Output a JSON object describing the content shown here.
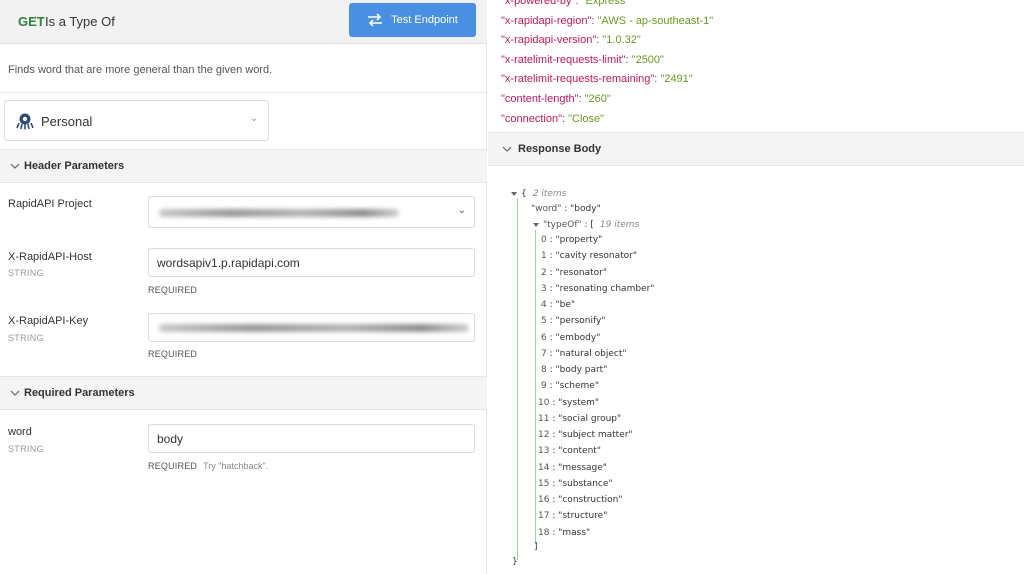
{
  "endpoint": {
    "method": "GET",
    "name": "Is a Type Of",
    "test_button_label": "Test Endpoint",
    "description": "Finds word that are more general than the given word."
  },
  "account_select": {
    "label": "Personal"
  },
  "header_parameters": {
    "title": "Header Parameters",
    "project_label": "RapidAPI Project",
    "host_label": "X-RapidAPI-Host",
    "host_type": "STRING",
    "host_value": "wordsapiv1.p.rapidapi.com",
    "host_required": "REQUIRED",
    "key_label": "X-RapidAPI-Key",
    "key_type": "STRING",
    "key_required": "REQUIRED"
  },
  "required_parameters": {
    "title": "Required Parameters",
    "word_label": "word",
    "word_type": "STRING",
    "word_value": "body",
    "word_required": "REQUIRED",
    "word_hint": "Try \"hatchback\"."
  },
  "response_headers": [
    {
      "key": "\"x-powered-by\"",
      "value": "\"Express\""
    },
    {
      "key": "\"x-rapidapi-region\"",
      "value": "\"AWS - ap-southeast-1\""
    },
    {
      "key": "\"x-rapidapi-version\"",
      "value": "\"1.0.32\""
    },
    {
      "key": "\"x-ratelimit-requests-limit\"",
      "value": "\"2500\""
    },
    {
      "key": "\"x-ratelimit-requests-remaining\"",
      "value": "\"2491\""
    },
    {
      "key": "\"content-length\"",
      "value": "\"260\""
    },
    {
      "key": "\"connection\"",
      "value": "\"Close\""
    }
  ],
  "response_body": {
    "title": "Response Body",
    "root_open": "{",
    "root_count": "2 items",
    "word_key": "\"word\"",
    "word_value": "\"body\"",
    "typeof_key": "\"typeOf\"",
    "typeof_open": "[",
    "typeof_count": "19 items",
    "typeof_items": [
      "\"property\"",
      "\"cavity resonator\"",
      "\"resonator\"",
      "\"resonating chamber\"",
      "\"be\"",
      "\"personify\"",
      "\"embody\"",
      "\"natural object\"",
      "\"body part\"",
      "\"scheme\"",
      "\"system\"",
      "\"social group\"",
      "\"subject matter\"",
      "\"content\"",
      "\"message\"",
      "\"substance\"",
      "\"construction\"",
      "\"structure\"",
      "\"mass\""
    ],
    "typeof_close": "]",
    "root_close": "}"
  },
  "colors": {
    "method": "#2e8540",
    "button": "#4a90e2",
    "header_key": "#c2185b",
    "header_value": "#6a9a1f"
  }
}
